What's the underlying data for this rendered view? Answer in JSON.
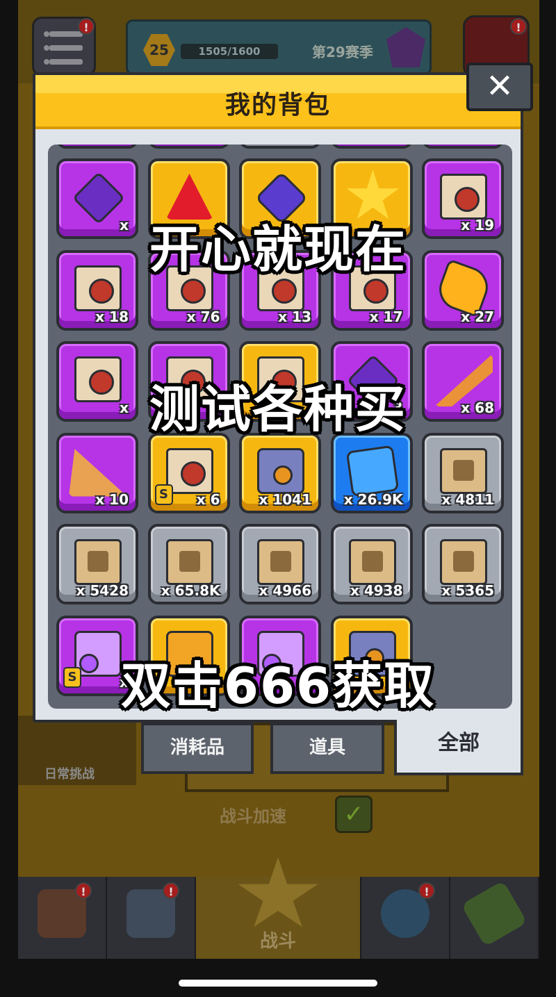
{
  "background": {
    "level": "25",
    "xp_text": "1505/1600",
    "season_label": "第29赛季",
    "notification_mark": "!",
    "daily_challenge_label": "日常挑战",
    "battle_speed_label": "战斗加速",
    "battle_label": "战斗"
  },
  "modal": {
    "title": "我的背包",
    "close_label": "✕"
  },
  "items": [
    {
      "kind": "crystal",
      "color": "purple",
      "count": "x"
    },
    {
      "kind": "red-tri",
      "color": "gold",
      "count": ""
    },
    {
      "kind": "gem",
      "color": "gold",
      "count": ""
    },
    {
      "kind": "star",
      "color": "gold",
      "count": ""
    },
    {
      "kind": "puzzle",
      "color": "purple",
      "count": "x 19"
    },
    {
      "kind": "puzzle",
      "color": "purple",
      "count": "x 18"
    },
    {
      "kind": "puzzle",
      "color": "purple",
      "count": "x 76"
    },
    {
      "kind": "puzzle",
      "color": "purple",
      "count": "x 13"
    },
    {
      "kind": "puzzle",
      "color": "purple",
      "count": "x 17"
    },
    {
      "kind": "topaz",
      "color": "purple",
      "count": "x 27"
    },
    {
      "kind": "puzzle",
      "color": "purple",
      "count": "x"
    },
    {
      "kind": "puzzle",
      "color": "purple",
      "count": "8"
    },
    {
      "kind": "puzzle",
      "color": "gold",
      "count": ""
    },
    {
      "kind": "crystal",
      "color": "purple",
      "count": "3"
    },
    {
      "kind": "pizza",
      "color": "purple",
      "count": "x 68"
    },
    {
      "kind": "pizza2",
      "color": "purple",
      "count": "x 10"
    },
    {
      "kind": "puzzle",
      "color": "gold",
      "count": "x 6",
      "badge": "S"
    },
    {
      "kind": "chest",
      "color": "gold",
      "count": "x 1041"
    },
    {
      "kind": "circuit",
      "color": "blue",
      "count": "x 26.9K"
    },
    {
      "kind": "scroll",
      "color": "gray",
      "count": "x 4811"
    },
    {
      "kind": "scroll",
      "color": "gray",
      "count": "x 5428"
    },
    {
      "kind": "scroll",
      "color": "gray",
      "count": "x 65.8K"
    },
    {
      "kind": "scroll",
      "color": "gray",
      "count": "x 4966"
    },
    {
      "kind": "scroll",
      "color": "gray",
      "count": "x 4938"
    },
    {
      "kind": "scroll",
      "color": "gray",
      "count": "x 5365"
    },
    {
      "kind": "chest-p",
      "color": "purple",
      "count": "x",
      "badge": "S"
    },
    {
      "kind": "chest-g",
      "color": "gold",
      "count": ""
    },
    {
      "kind": "chest-p",
      "color": "purple",
      "count": ""
    },
    {
      "kind": "chest",
      "color": "gold",
      "count": "3"
    }
  ],
  "tabs": {
    "consumables": "消耗品",
    "props": "道具",
    "all": "全部"
  },
  "captions": {
    "line1": "开心就现在",
    "line2": "测试各种买",
    "line3": "双击666获取"
  }
}
